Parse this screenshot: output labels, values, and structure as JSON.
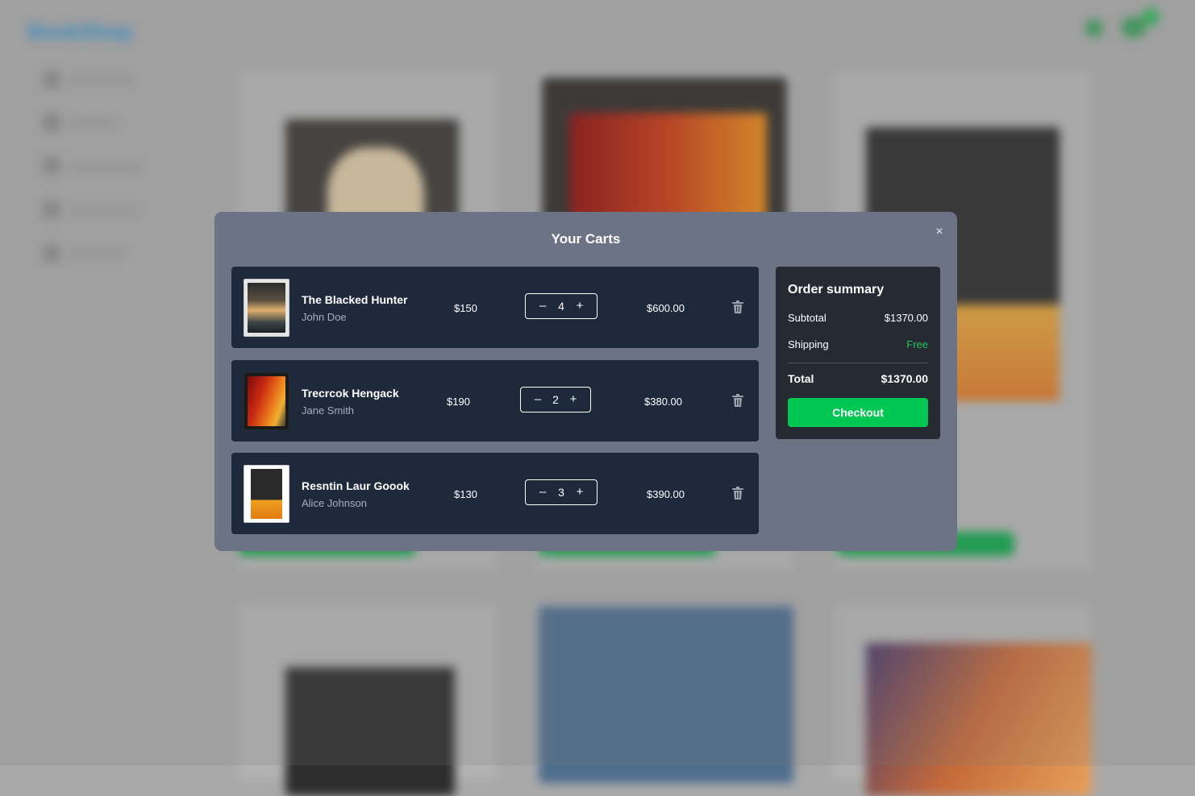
{
  "background": {
    "logo": "BookShop"
  },
  "modal": {
    "title": "Your Carts",
    "close_label": "×",
    "items": [
      {
        "title": "The Blacked Hunter",
        "author": "John Doe",
        "price": "$150",
        "quantity": "4",
        "subtotal": "$600.00",
        "minus": "–",
        "plus": "+"
      },
      {
        "title": "Trecrcok Hengack",
        "author": "Jane Smith",
        "price": "$190",
        "quantity": "2",
        "subtotal": "$380.00",
        "minus": "–",
        "plus": "+"
      },
      {
        "title": "Resntin Laur Goook",
        "author": "Alice Johnson",
        "price": "$130",
        "quantity": "3",
        "subtotal": "$390.00",
        "minus": "–",
        "plus": "+"
      }
    ],
    "summary": {
      "title": "Order summary",
      "subtotal_label": "Subtotal",
      "subtotal_value": "$1370.00",
      "shipping_label": "Shipping",
      "shipping_value": "Free",
      "total_label": "Total",
      "total_value": "$1370.00",
      "checkout_label": "Checkout"
    }
  },
  "colors": {
    "modal_bg": "#6b7385",
    "item_bg": "#1e293b",
    "summary_bg": "#262b33",
    "accent_green": "#00c853",
    "free_green": "#22c55e"
  }
}
